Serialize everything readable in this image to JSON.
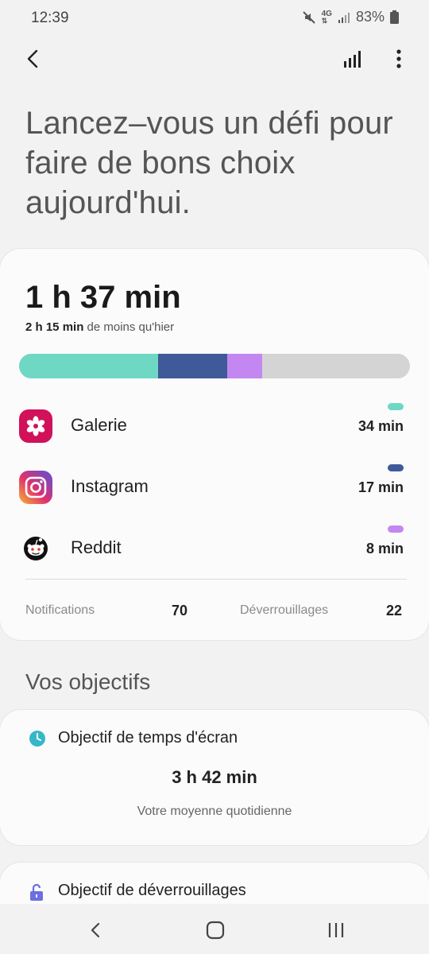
{
  "status": {
    "time": "12:39",
    "network": "4G",
    "battery": "83%"
  },
  "appbar": {
    "back_icon": "back-arrow-icon",
    "stats_icon": "bar-chart-icon",
    "more_icon": "more-vert-icon"
  },
  "headline": "Lancez–vous un défi pour faire de bons choix aujourd'hui.",
  "summary": {
    "total": "1 h 37 min",
    "less_amount": "2 h 15 min",
    "less_text": " de moins qu'hier",
    "bar": [
      {
        "app": "Galerie",
        "fraction": 0.355,
        "color": "#6ed8c4"
      },
      {
        "app": "Instagram",
        "fraction": 0.178,
        "color": "#3e5a98"
      },
      {
        "app": "Reddit",
        "fraction": 0.088,
        "color": "#c487f2"
      }
    ]
  },
  "apps": [
    {
      "name": "Galerie",
      "time": "34 min",
      "color": "#6ed8c4",
      "icon": "gallery-flower-icon"
    },
    {
      "name": "Instagram",
      "time": "17 min",
      "color": "#3e5a98",
      "icon": "instagram-icon"
    },
    {
      "name": "Reddit",
      "time": "8 min",
      "color": "#c487f2",
      "icon": "reddit-icon"
    }
  ],
  "stats": {
    "notifications_label": "Notifications",
    "notifications_value": "70",
    "unlocks_label": "Déverrouillages",
    "unlocks_value": "22"
  },
  "goals": {
    "section_title": "Vos objectifs",
    "screen_time": {
      "title": "Objectif de temps d'écran",
      "value": "3 h 42 min",
      "subtitle": "Votre moyenne quotidienne",
      "icon": "clock-icon",
      "icon_color": "#35b7c9"
    },
    "unlocks": {
      "title": "Objectif de déverrouillages",
      "icon": "unlock-icon",
      "icon_color": "#6b6fe0"
    }
  },
  "navbar": {
    "back": "nav-back-icon",
    "home": "nav-home-icon",
    "recents": "nav-recents-icon"
  }
}
